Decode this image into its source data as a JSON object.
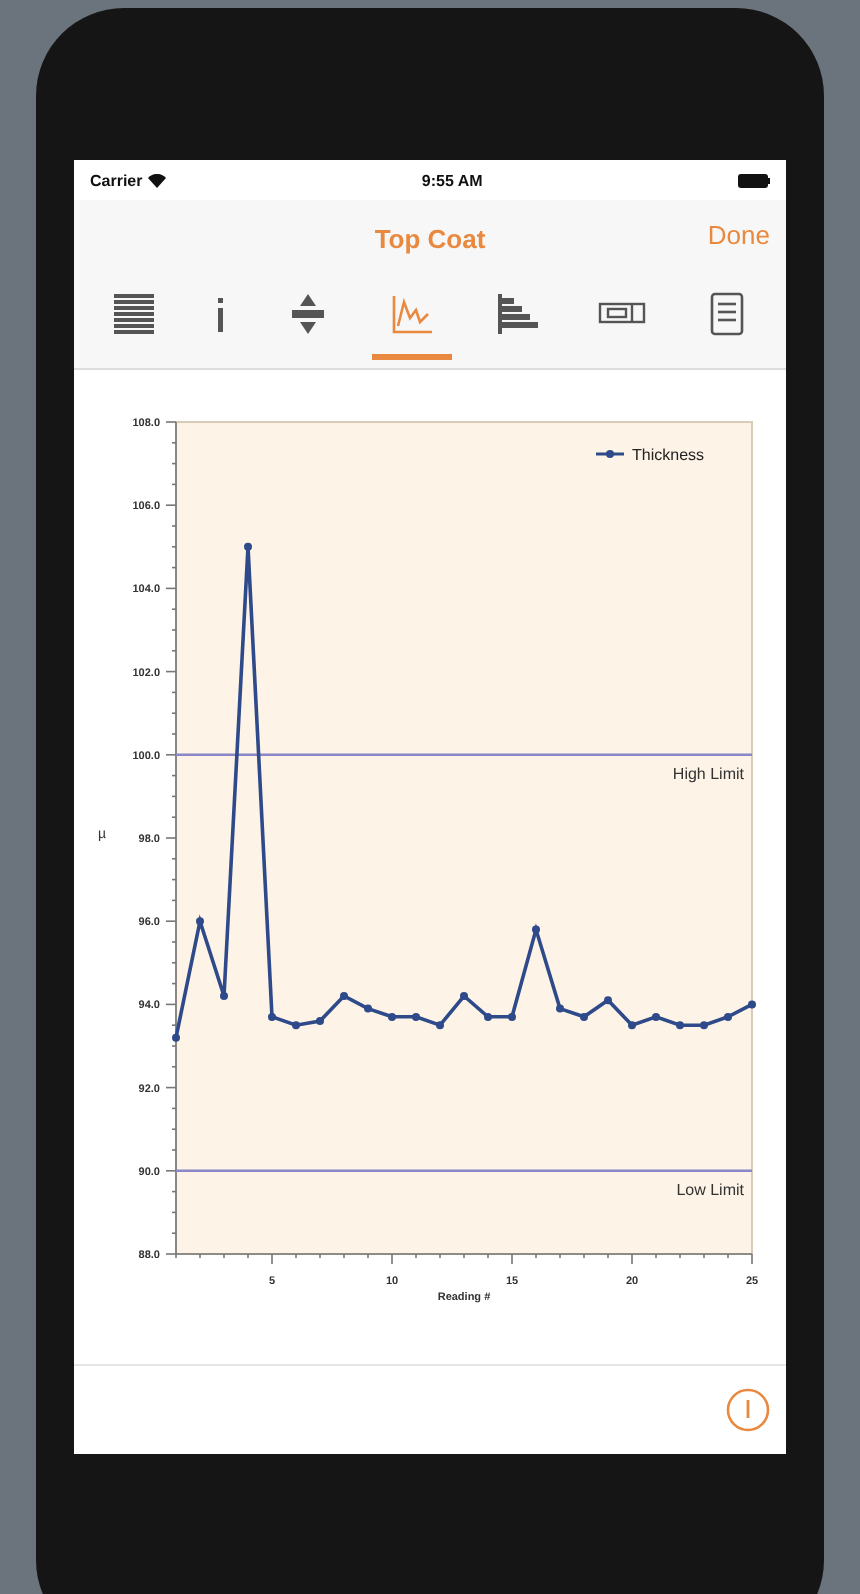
{
  "status_bar": {
    "carrier": "Carrier",
    "time": "9:55 AM"
  },
  "nav_bar": {
    "title": "Top Coat",
    "done": "Done"
  },
  "tabs": [
    {
      "selected": false
    },
    {
      "selected": false
    },
    {
      "selected": false
    },
    {
      "selected": true
    },
    {
      "selected": false
    },
    {
      "selected": false
    },
    {
      "selected": false
    }
  ],
  "chart": {
    "chart_data": {
      "type": "line",
      "xlabel": "Reading #",
      "ylabel": "µ",
      "x": [
        1,
        2,
        3,
        4,
        5,
        6,
        7,
        8,
        9,
        10,
        11,
        12,
        13,
        14,
        15,
        16,
        17,
        18,
        19,
        20,
        21,
        22,
        23,
        24,
        25
      ],
      "series": [
        {
          "name": "Thickness",
          "color": "#2e4a8a",
          "marker": "circle",
          "values": [
            93.2,
            96.0,
            94.2,
            105.0,
            93.7,
            93.5,
            93.6,
            94.2,
            93.9,
            93.7,
            93.7,
            93.5,
            94.2,
            93.7,
            93.7,
            95.8,
            93.9,
            93.7,
            94.1,
            93.5,
            93.7,
            93.5,
            93.5,
            93.7,
            94.0
          ]
        }
      ],
      "xlim": [
        1,
        25
      ],
      "ylim": [
        88,
        108
      ],
      "xticks": [
        5,
        10,
        15,
        20,
        25
      ],
      "yticks": [
        {
          "value": 88,
          "label": "88.0"
        },
        {
          "value": 90,
          "label": "90.0"
        },
        {
          "value": 92,
          "label": "92.0"
        },
        {
          "value": 94,
          "label": "94.0"
        },
        {
          "value": 96,
          "label": "96.0"
        },
        {
          "value": 98,
          "label": "98.0"
        },
        {
          "value": 100,
          "label": "100.0"
        },
        {
          "value": 102,
          "label": "102.0"
        },
        {
          "value": 104,
          "label": "104.0"
        },
        {
          "value": 106,
          "label": "106.0"
        },
        {
          "value": 108,
          "label": "108.0"
        }
      ],
      "ref_lines": [
        {
          "axis": "y",
          "value": 100,
          "label": "High Limit"
        },
        {
          "axis": "y",
          "value": 90,
          "label": "Low Limit"
        }
      ]
    }
  }
}
